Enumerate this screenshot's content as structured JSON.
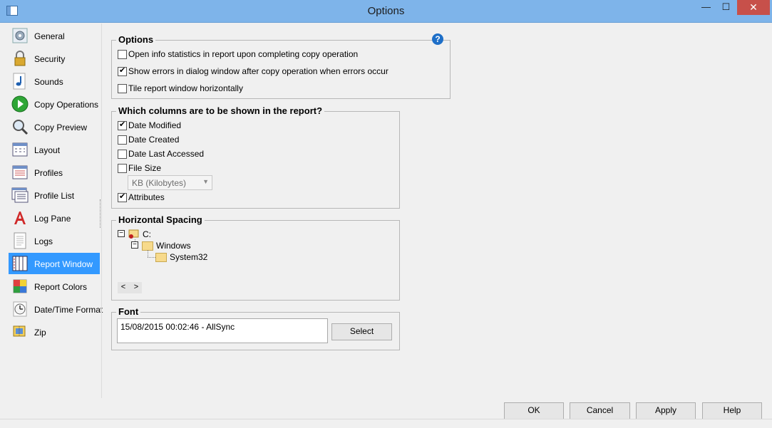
{
  "window": {
    "title": "Options",
    "min": "—",
    "max": "☐",
    "close": "✕"
  },
  "sidebar": {
    "items": [
      {
        "label": "General",
        "icon": "gear-icon"
      },
      {
        "label": "Security",
        "icon": "lock-icon"
      },
      {
        "label": "Sounds",
        "icon": "music-note-icon"
      },
      {
        "label": "Copy Operations",
        "icon": "play-icon"
      },
      {
        "label": "Copy Preview",
        "icon": "magnifier-icon"
      },
      {
        "label": "Layout",
        "icon": "layout-icon"
      },
      {
        "label": "Profiles",
        "icon": "profiles-icon"
      },
      {
        "label": "Profile List",
        "icon": "profile-list-icon"
      },
      {
        "label": "Log Pane",
        "icon": "font-letter-icon"
      },
      {
        "label": "Logs",
        "icon": "document-icon"
      },
      {
        "label": "Report Window",
        "icon": "report-window-icon",
        "selected": true
      },
      {
        "label": "Report Colors",
        "icon": "color-palette-icon"
      },
      {
        "label": "Date/Time Format",
        "icon": "clock-icon"
      },
      {
        "label": "Zip",
        "icon": "zip-icon"
      }
    ]
  },
  "options": {
    "title": "Options",
    "help": "?",
    "items": [
      {
        "label": "Open info statistics in report upon completing copy operation",
        "checked": false
      },
      {
        "label": "Show errors in dialog window after copy operation when errors occur",
        "checked": true
      },
      {
        "label": "Tile report window horizontally",
        "checked": false
      }
    ]
  },
  "columns": {
    "title": "Which columns are to be shown in the report?",
    "items": [
      {
        "label": "Date Modified",
        "checked": true
      },
      {
        "label": "Date Created",
        "checked": false
      },
      {
        "label": "Date Last Accessed",
        "checked": false
      },
      {
        "label": "File Size",
        "checked": false
      },
      {
        "label": "Attributes",
        "checked": true
      }
    ],
    "size_unit": "KB (Kilobytes)"
  },
  "spacing": {
    "title": "Horizontal Spacing",
    "tree": {
      "drive": "C:",
      "folder1": "Windows",
      "folder2": "System32"
    },
    "nav_left": "<",
    "nav_right": ">"
  },
  "font": {
    "title": "Font",
    "value": "15/08/2015 00:02:46 - AllSync",
    "select_label": "Select"
  },
  "footer": {
    "ok": "OK",
    "cancel": "Cancel",
    "apply": "Apply",
    "help": "Help"
  }
}
